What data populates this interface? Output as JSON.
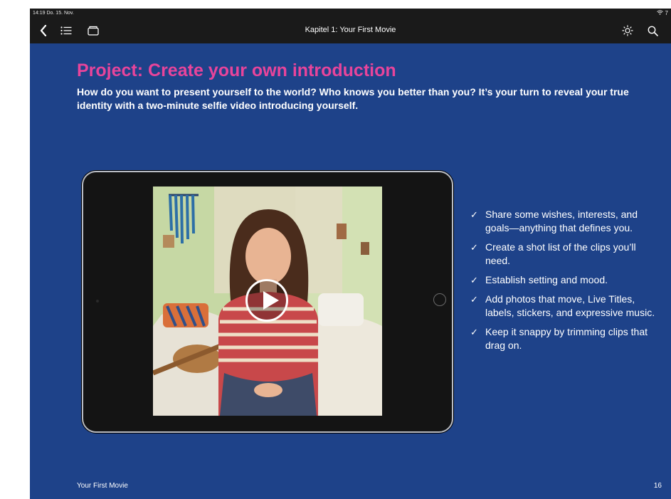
{
  "status_bar": {
    "time": "14:19  Do. 15. Nov.",
    "right": "7"
  },
  "toolbar": {
    "title": "Kapitel 1: Your First Movie"
  },
  "page": {
    "heading": "Project: Create your own introduction",
    "intro": "How do you want to present yourself to the world? Who knows you better than you? It’s your turn to reveal your true identity with a two-minute selfie video introducing yourself.",
    "checklist": [
      "Share some wishes, interests, and goals—anything that defines you.",
      "Create a shot list of the clips you’ll need.",
      "Establish setting and mood.",
      "Add photos that move, Live Titles, labels, stickers, and expressive music.",
      "Keep it snappy by trimming clips that drag on."
    ],
    "check_symbol": "✓"
  },
  "footer": {
    "left": "Your First Movie",
    "page_number": "16"
  },
  "colors": {
    "background": "#1e4289",
    "heading": "#e8449b",
    "toolbar": "#1a1a1a"
  },
  "icons": [
    "back-chevron-icon",
    "table-of-contents-icon",
    "library-icon",
    "brightness-icon",
    "search-icon",
    "wifi-icon",
    "play-icon"
  ]
}
